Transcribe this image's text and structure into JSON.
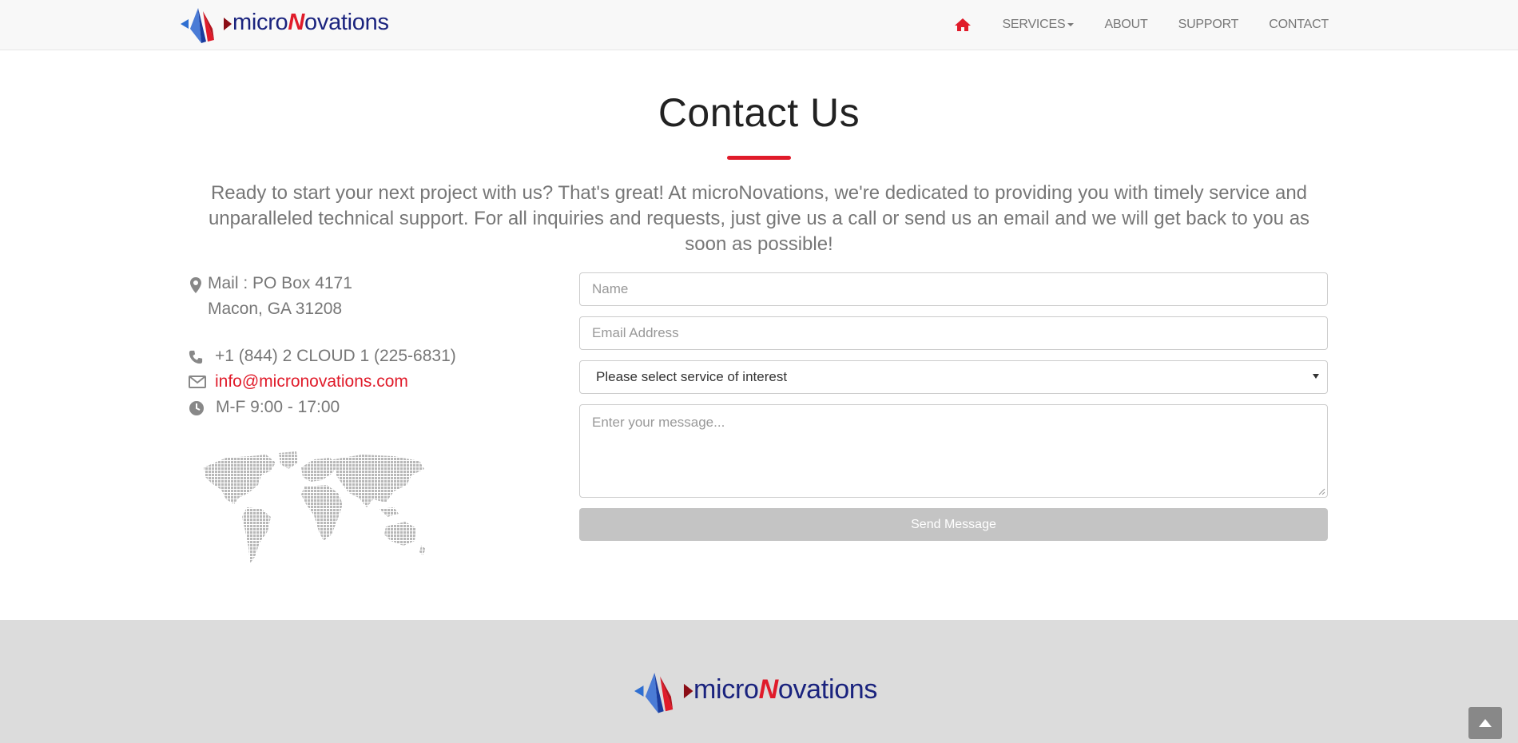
{
  "brand": {
    "logo_text_a": "micro",
    "logo_text_b": "N",
    "logo_text_c": "ovations",
    "colors": {
      "red": "#e01b2a",
      "navy": "#1a237e",
      "blue": "#2f6fd1"
    }
  },
  "nav": {
    "home_icon": "home-icon",
    "items": [
      "SERVICES",
      "ABOUT",
      "SUPPORT",
      "CONTACT"
    ]
  },
  "header": {
    "title": "Contact Us",
    "intro": "Ready to start your next project with us? That's great! At microNovations, we're dedicated to providing you with timely service and unparalleled technical support. For all inquiries and requests, just give us a call or send us an email and we will get back to you as soon as possible!"
  },
  "contact": {
    "mail_line1": "Mail : PO Box 4171",
    "mail_line2": "Macon, GA 31208",
    "phone": "+1 (844) 2 CLOUD 1 (225-6831)",
    "email": "info@micronovations.com",
    "hours": "M-F 9:00 - 17:00",
    "icons": [
      "map-marker-icon",
      "phone-icon",
      "envelope-icon",
      "clock-icon"
    ]
  },
  "form": {
    "name_placeholder": "Name",
    "email_placeholder": "Email Address",
    "service_selected": "Please select service of interest",
    "message_placeholder": "Enter your message...",
    "submit_label": "Send Message"
  }
}
